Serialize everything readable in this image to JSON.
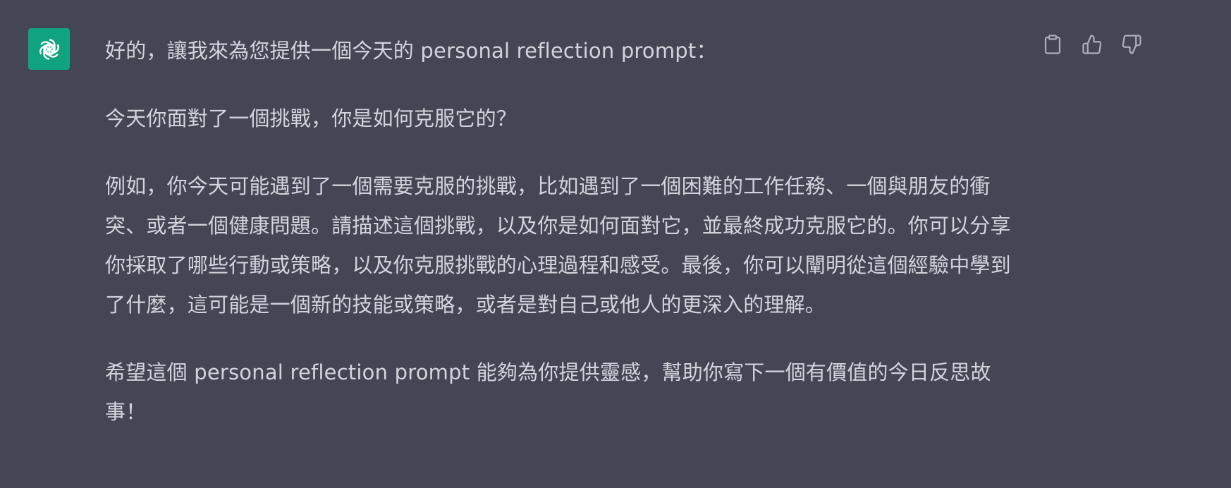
{
  "message": {
    "role": "assistant",
    "avatar_icon": "openai-logo-icon",
    "avatar_color": "#10a37f",
    "paragraphs": [
      "好的，讓我來為您提供一個今天的 personal reflection prompt：",
      "今天你面對了一個挑戰，你是如何克服它的？",
      "例如，你今天可能遇到了一個需要克服的挑戰，比如遇到了一個困難的工作任務、一個與朋友的衝突、或者一個健康問題。請描述這個挑戰，以及你是如何面對它，並最終成功克服它的。你可以分享你採取了哪些行動或策略，以及你克服挑戰的心理過程和感受。最後，你可以闡明從這個經驗中學到了什麼，這可能是一個新的技能或策略，或者是對自己或他人的更深入的理解。",
      "希望這個 personal reflection prompt 能夠為你提供靈感，幫助你寫下一個有價值的今日反思故事！"
    ]
  },
  "actions": {
    "copy_icon": "clipboard-icon",
    "like_icon": "thumbs-up-icon",
    "dislike_icon": "thumbs-down-icon"
  },
  "colors": {
    "background": "#444654",
    "text": "#d1d5db",
    "icon": "#acacbe"
  }
}
